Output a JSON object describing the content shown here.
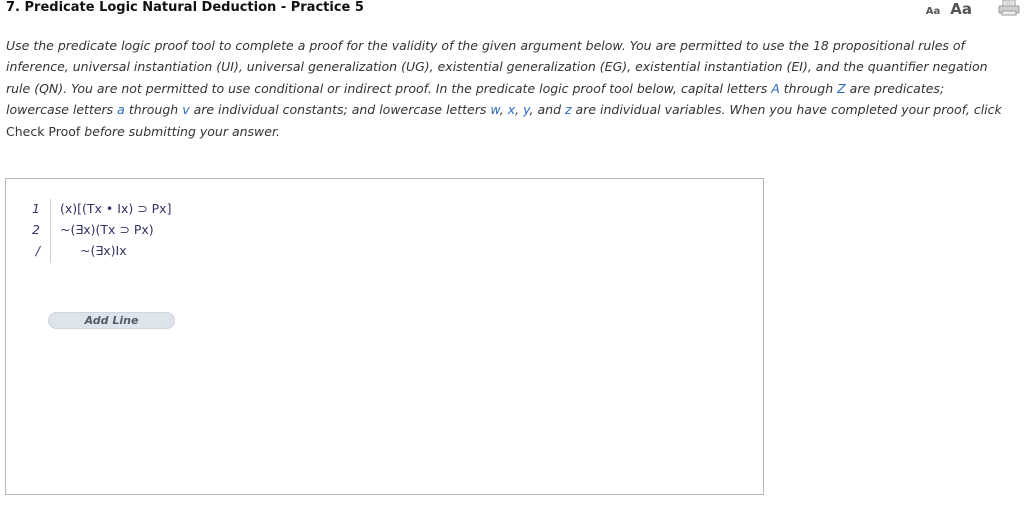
{
  "header": {
    "title": "7. Predicate Logic Natural Deduction - Practice 5",
    "font_small_label": "Aa",
    "font_large_label": "Aa",
    "print_icon": "printer-icon"
  },
  "instructions": {
    "p1": "Use the predicate logic proof tool to complete a proof for the validity of the given argument below. You are permitted to use the 18 propositional rules of inference, universal instantiation (UI), universal generalization (UG), existential generalization (EG), existential instantiation (EI), and the quantifier negation rule (QN). You are not permitted to use conditional or indirect proof. In the predicate logic proof tool below, capital letters ",
    "hl_A": "A",
    "p2": " through ",
    "hl_Z": "Z",
    "p3": " are predicates; lowercase letters ",
    "hl_a": "a",
    "p4": " through ",
    "hl_v": "v",
    "p5": " are individual constants; and lowercase letters ",
    "hl_w": "w",
    "sep1": ", ",
    "hl_x": "x",
    "sep2": ", ",
    "hl_y": "y",
    "p6": ", and ",
    "hl_z": "z",
    "p7": " are individual variables. When you have completed your proof, click ",
    "check_proof": "Check Proof",
    "p8": " before submitting your answer."
  },
  "proof": {
    "lines": [
      {
        "num": "1",
        "formula": "(x)[(Tx • Ix) ⊃ Px]"
      },
      {
        "num": "2",
        "formula": "~(∃x)(Tx ⊃ Px)"
      }
    ],
    "conclusion": {
      "num": "/",
      "formula": "~(∃x)Ix"
    },
    "add_line_label": "Add Line"
  }
}
